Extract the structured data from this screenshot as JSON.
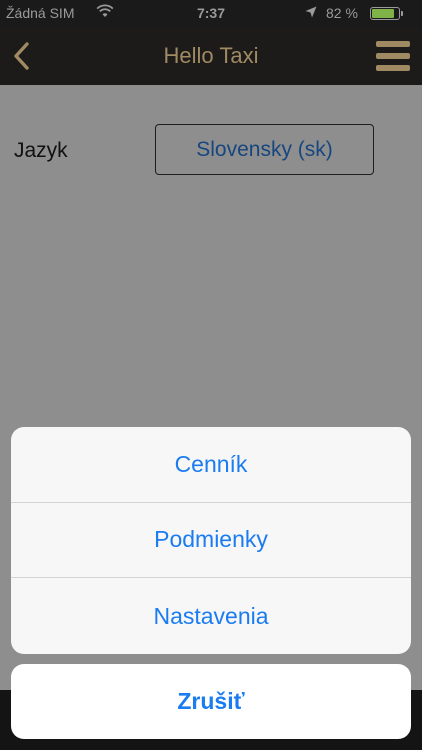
{
  "status_bar": {
    "carrier": "Žádná SIM",
    "time": "7:37",
    "battery_percent": "82 %",
    "battery_level": 0.82,
    "battery_color": "#7fb247"
  },
  "nav_bar": {
    "back_icon": "chevron-left-icon",
    "title": "Hello Taxi",
    "menu_icon": "hamburger-menu-icon",
    "accent_color": "#a08a62"
  },
  "settings": {
    "language_label": "Jazyk",
    "language_value": "Slovensky (sk)"
  },
  "action_sheet": {
    "items": [
      {
        "label": "Cenník"
      },
      {
        "label": "Podmienky"
      },
      {
        "label": "Nastavenia"
      }
    ],
    "cancel_label": "Zrušiť",
    "action_color": "#1a7cf0"
  }
}
